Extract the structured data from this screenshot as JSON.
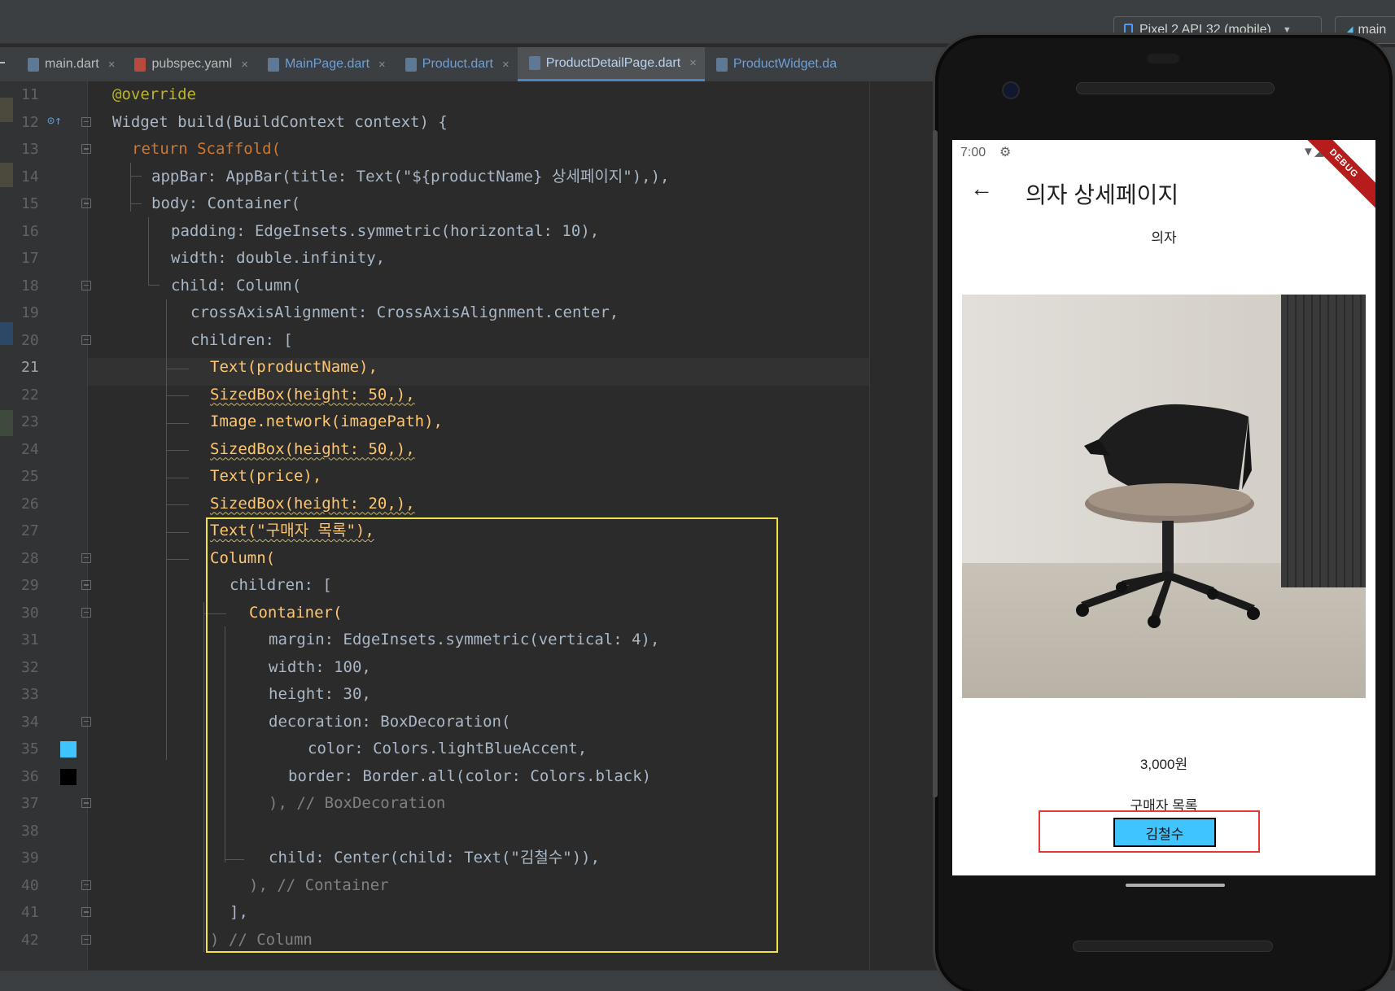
{
  "toolbar": {
    "device": "Pixel 2 API 32 (mobile)",
    "branch": "main"
  },
  "tabs": [
    {
      "label": "main.dart",
      "icon": "dart-file-icon"
    },
    {
      "label": "pubspec.yaml",
      "icon": "yaml-file-icon"
    },
    {
      "label": "MainPage.dart",
      "icon": "dart-file-icon"
    },
    {
      "label": "Product.dart",
      "icon": "dart-file-icon"
    },
    {
      "label": "ProductDetailPage.dart",
      "icon": "dart-file-icon",
      "active": true
    },
    {
      "label": "ProductWidget.da",
      "icon": "dart-file-icon"
    }
  ],
  "editor": {
    "current_line": 21,
    "line_numbers": [
      "11",
      "12",
      "13",
      "14",
      "15",
      "16",
      "17",
      "18",
      "19",
      "20",
      "21",
      "22",
      "23",
      "24",
      "25",
      "26",
      "27",
      "28",
      "29",
      "30",
      "31",
      "32",
      "33",
      "34",
      "35",
      "36",
      "37",
      "38",
      "39",
      "40",
      "41",
      "42"
    ],
    "color_swatches": {
      "line_35": "#40C4FF",
      "line_36": "#000000"
    },
    "lines": {
      "l11": "@override",
      "l12": "Widget build(BuildContext context) {",
      "l13": "return Scaffold(",
      "l14": "appBar: AppBar(title: Text(\"${productName} 상세페이지\"),),",
      "l15": "body: Container(",
      "l16": "padding: EdgeInsets.symmetric(horizontal: 10),",
      "l17": "width: double.infinity,",
      "l18": "child: Column(",
      "l19": "crossAxisAlignment: CrossAxisAlignment.center,",
      "l20": "children: [",
      "l21": "Text(productName),",
      "l22": "SizedBox(height: 50,),",
      "l23": "Image.network(imagePath),",
      "l24": "SizedBox(height: 50,),",
      "l25": "Text(price),",
      "l26": "SizedBox(height: 20,),",
      "l27": "Text(\"구매자 목록\"),",
      "l28": "Column(",
      "l29": "children: [",
      "l30": "Container(",
      "l31": "margin: EdgeInsets.symmetric(vertical: 4),",
      "l32": "width: 100,",
      "l33": "height: 30,",
      "l34": "decoration: BoxDecoration(",
      "l35": "color: Colors.lightBlueAccent,",
      "l36": "border: Border.all(color: Colors.black)",
      "l37": "), // BoxDecoration",
      "l38": "",
      "l39": "child: Center(child: Text(\"김철수\")),",
      "l40": "), // Container",
      "l41": "],",
      "l42": ") // Column"
    }
  },
  "phone": {
    "status_time": "7:00",
    "debug_banner": "DEBUG",
    "appbar_title": "의자 상세페이지",
    "product_name": "의자",
    "price": "3,000원",
    "buyer_list_title": "구매자 목록",
    "buyers": [
      "김철수"
    ],
    "buyer_color": "#40C4FF"
  }
}
